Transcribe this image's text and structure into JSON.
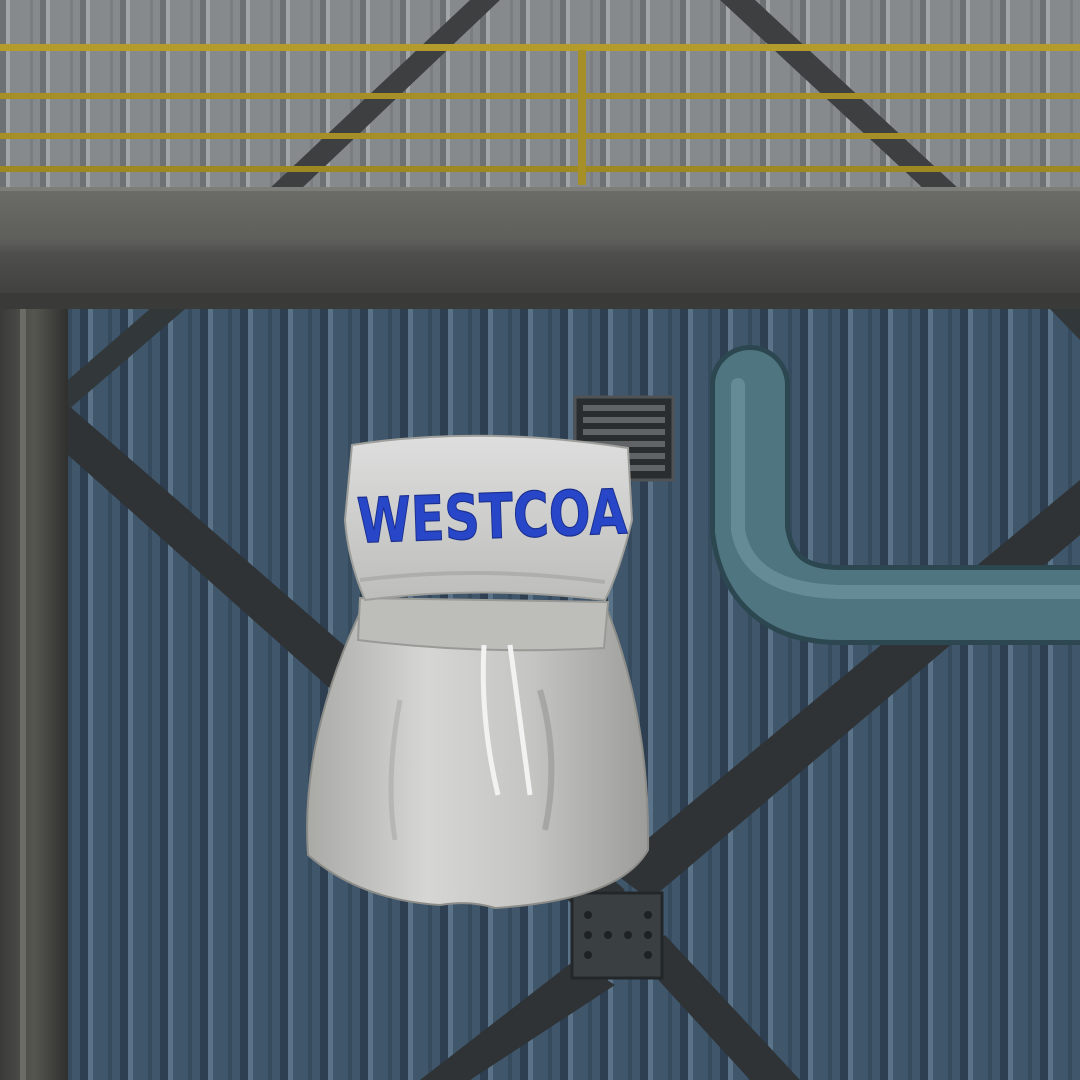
{
  "scene": {
    "garment_print_text": "WESTCOA",
    "colors": {
      "upper_wall": "#8e9193",
      "railing": "#b19a2a",
      "concrete_beam": "#5a5b58",
      "lower_wall": "#3e5468",
      "steel_brace": "#2e3234",
      "pipe": "#4e7580",
      "garment": "#c9c9c7",
      "print": "#2847c8"
    }
  }
}
